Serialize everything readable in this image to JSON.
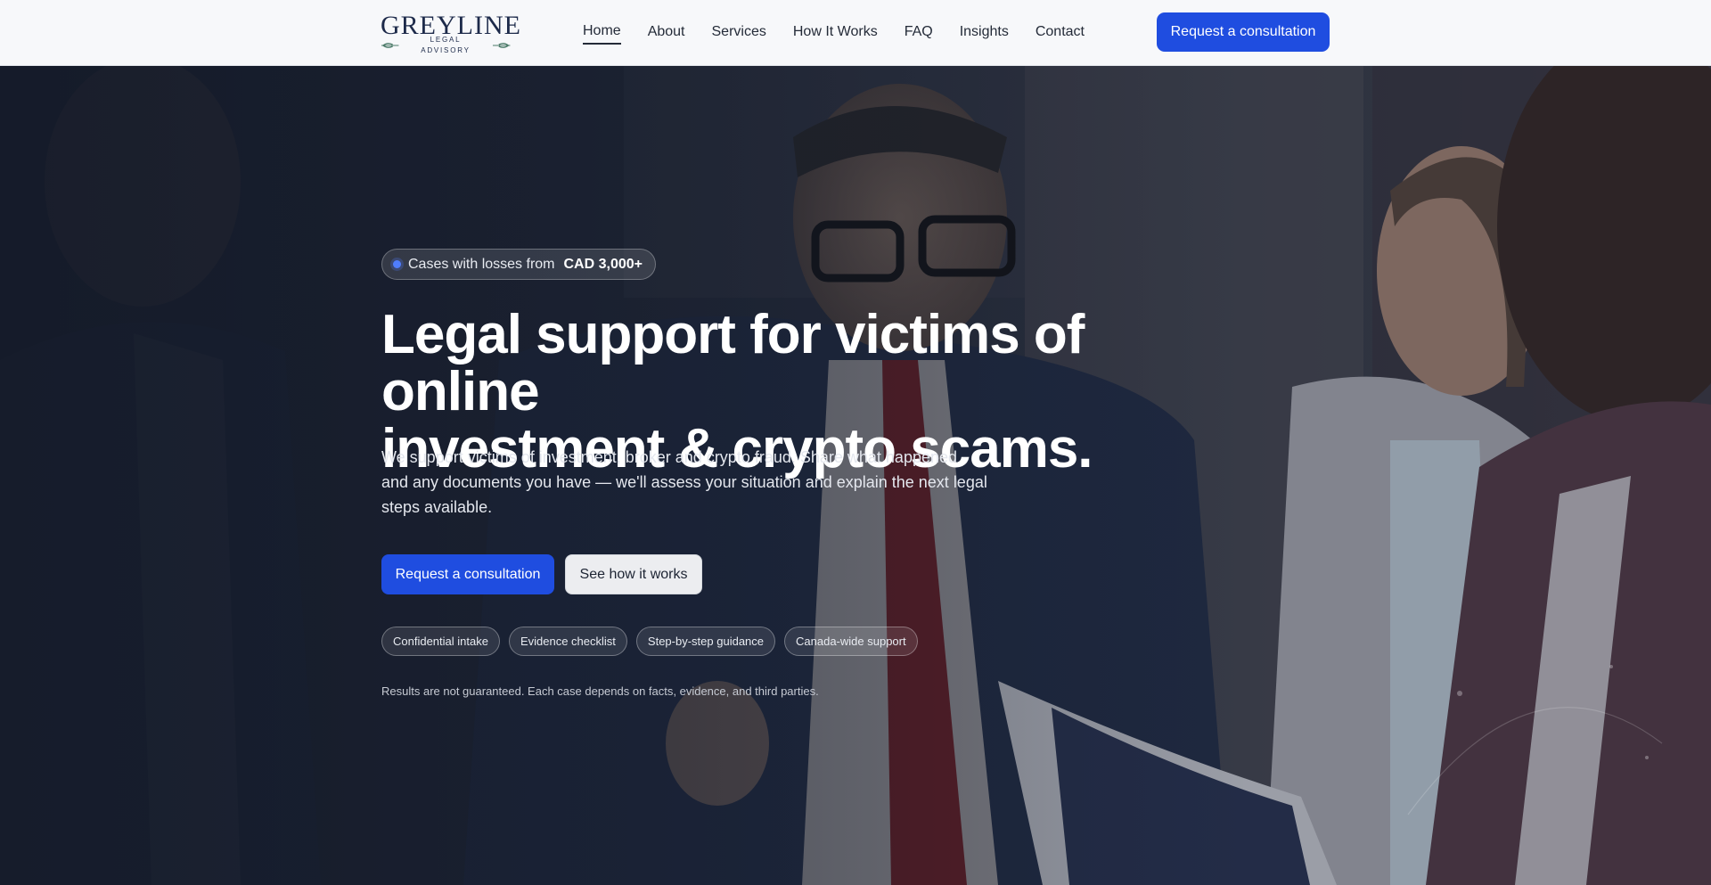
{
  "header": {
    "logo": {
      "name": "GREYLINE",
      "tagline": "LEGAL ADVISORY"
    },
    "nav": [
      {
        "label": "Home",
        "active": true
      },
      {
        "label": "About"
      },
      {
        "label": "Services"
      },
      {
        "label": "How It Works"
      },
      {
        "label": "FAQ"
      },
      {
        "label": "Insights"
      },
      {
        "label": "Contact"
      }
    ],
    "cta_label": "Request a consultation"
  },
  "hero": {
    "pill": {
      "text": "Cases with losses from",
      "highlight": "CAD 3,000+"
    },
    "headline_line1": "Legal support for victims of online",
    "headline_line2": "investment & crypto scams.",
    "lead": "We support victims of investment, broker and crypto fraud. Share what happened and any documents you have — we'll assess your situation and explain the next legal steps available.",
    "primary_button": "Request a consultation",
    "secondary_button": "See how it works",
    "chips": [
      "Confidential intake",
      "Evidence checklist",
      "Step-by-step guidance",
      "Canada-wide support"
    ],
    "disclaimer": "Results are not guaranteed. Each case depends on facts, evidence, and third parties."
  },
  "colors": {
    "accent": "#1f4de0",
    "header_bg": "#f7f8fa",
    "overlay": "#1c2231"
  }
}
